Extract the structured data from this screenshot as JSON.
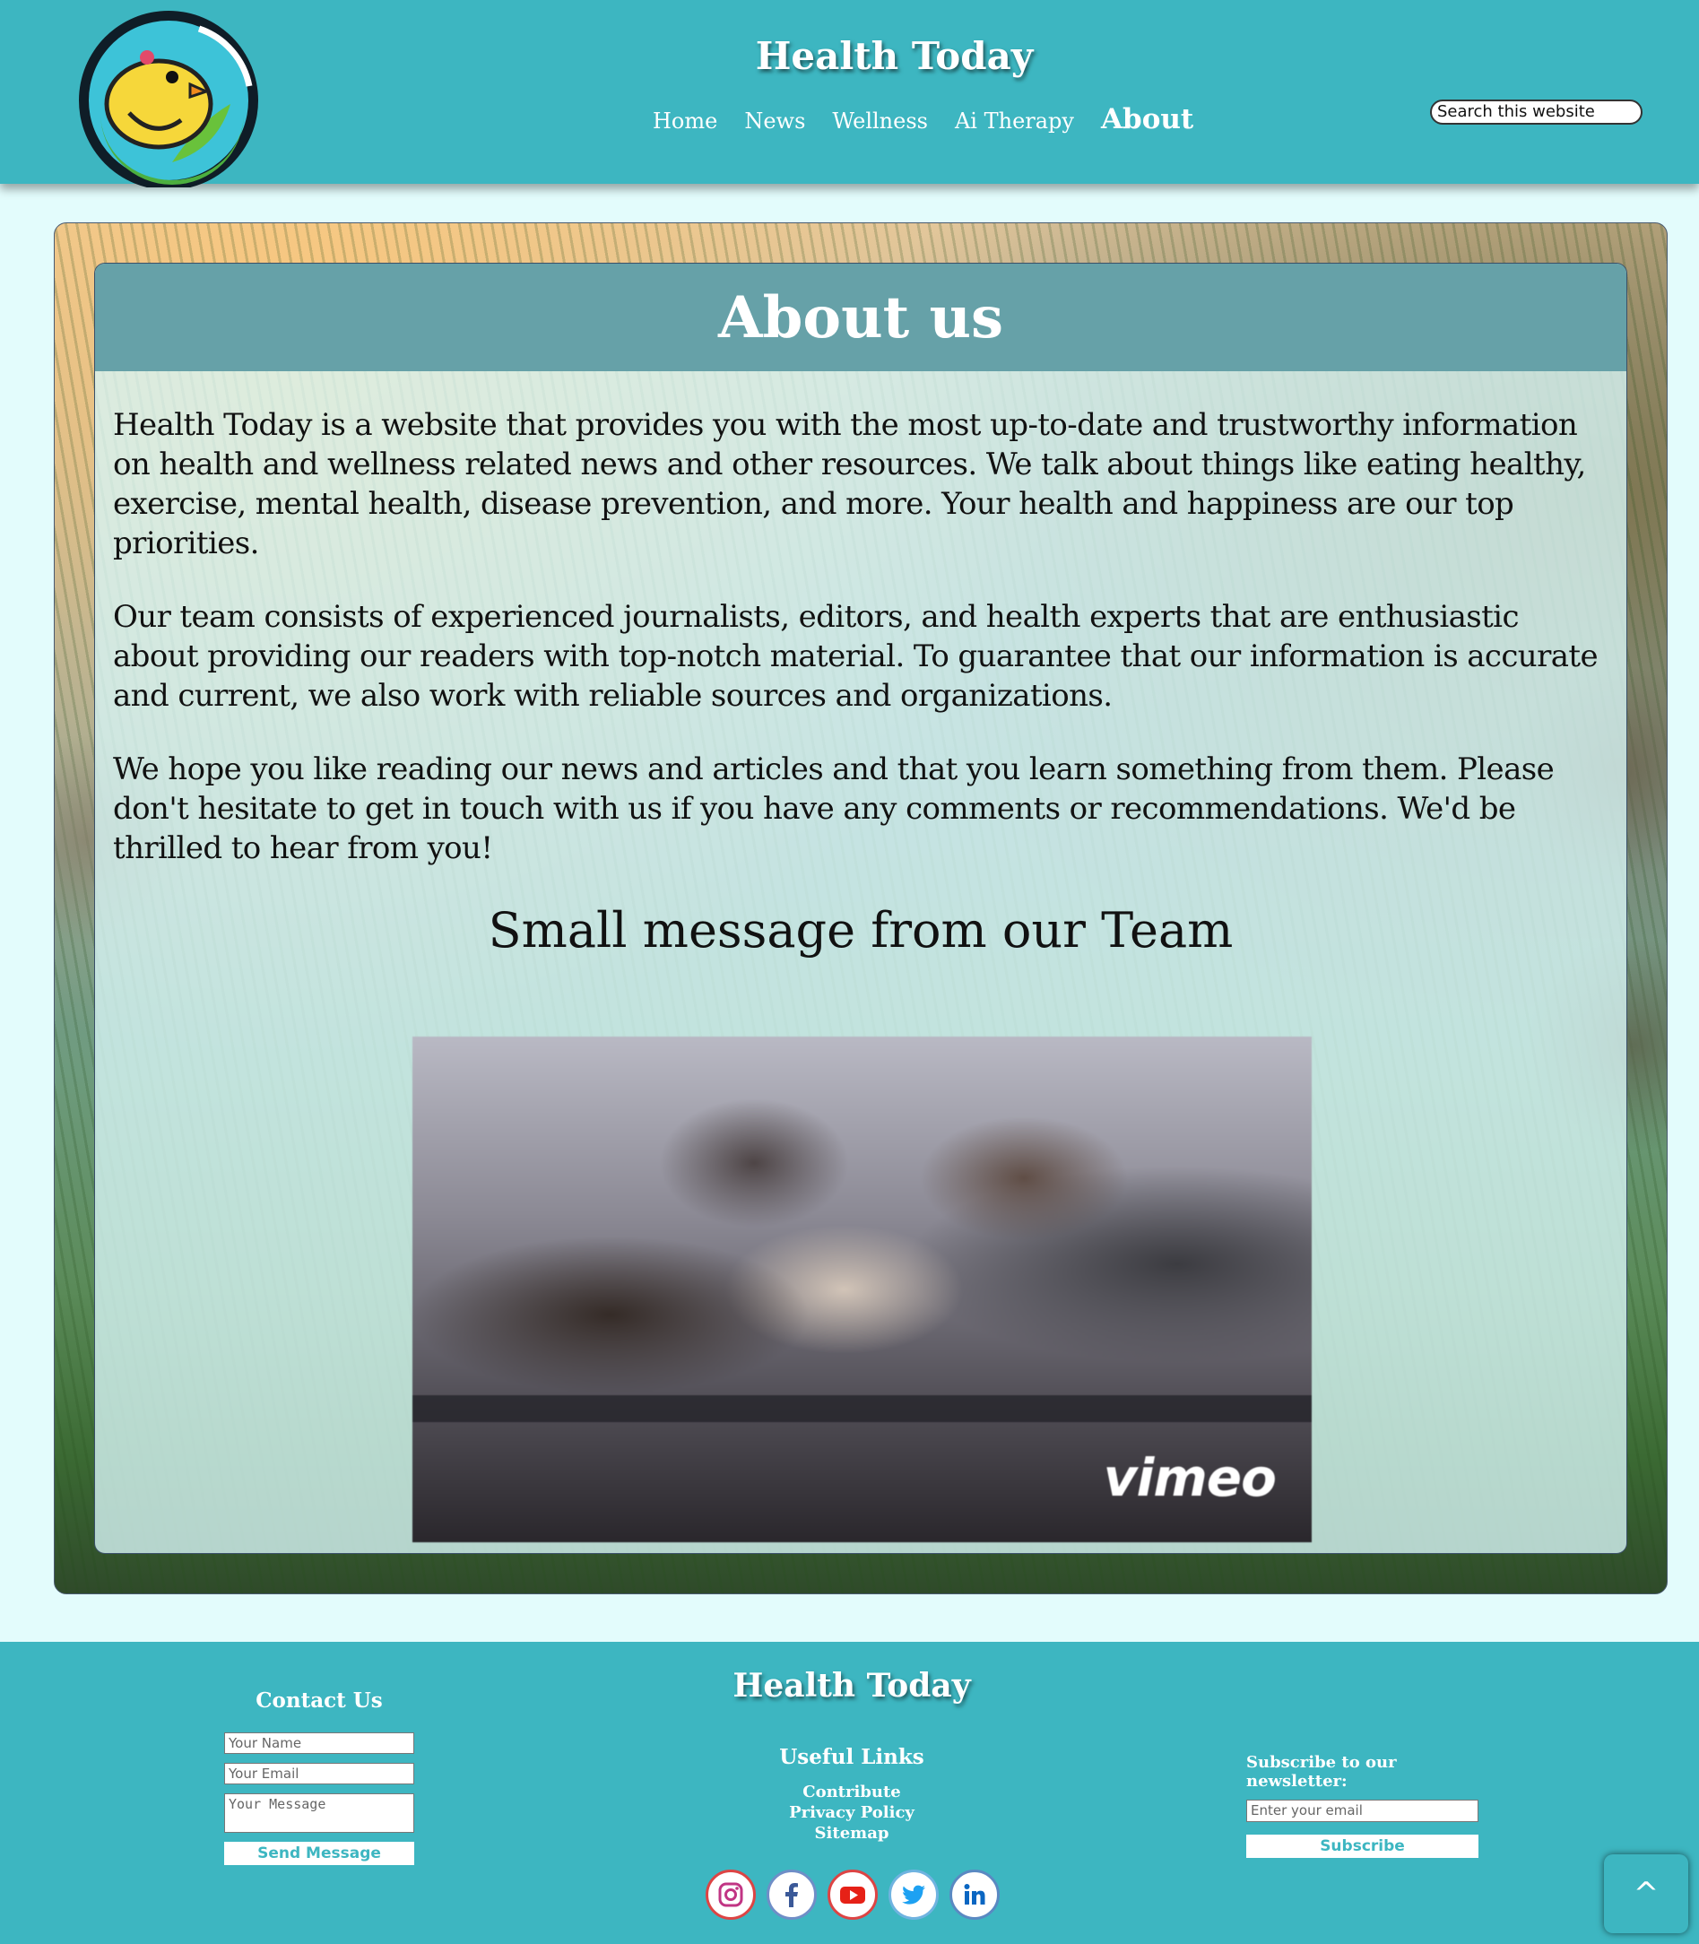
{
  "header": {
    "site_title": "Health Today",
    "nav": [
      "Home",
      "News",
      "Wellness",
      "Ai Therapy",
      "About"
    ],
    "active_nav": "About",
    "search_placeholder": "Search this website"
  },
  "about": {
    "title": "About us",
    "paragraphs": [
      "Health Today is a website that provides you with the most up-to-date and trustworthy information on health and wellness related news and other resources. We talk about things like eating healthy, exercise, mental health, disease prevention, and more. Your health and happiness are our top priorities.",
      "Our team consists of experienced journalists, editors, and health experts that are enthusiastic about providing our readers with top-notch material. To guarantee that our information is accurate and current, we also work with reliable sources and organizations.",
      "We hope you like reading our news and articles and that you learn something from them. Please don't hesitate to get in touch with us if you have any comments or recommendations. We'd be thrilled to hear from you!"
    ],
    "team_title": "Small message from our Team",
    "video_brand": "vimeo"
  },
  "footer": {
    "title": "Health Today",
    "contact": {
      "title": "Contact Us",
      "name_placeholder": "Your Name",
      "email_placeholder": "Your Email",
      "message_placeholder": "Your Message",
      "send_label": "Send Message"
    },
    "links": {
      "title": "Useful Links",
      "items": [
        "Contribute",
        "Privacy Policy",
        "Sitemap"
      ]
    },
    "social_icons": [
      "instagram-icon",
      "facebook-icon",
      "youtube-icon",
      "twitter-icon",
      "linkedin-icon"
    ],
    "newsletter": {
      "title": "Subscribe to our newsletter:",
      "placeholder": "Enter your email",
      "button": "Subscribe"
    },
    "back_to_top": "^"
  },
  "colors": {
    "header_bg": "#3db6c1",
    "panel_head": "#66a1a8",
    "page_bg": "#e3fcfc"
  }
}
